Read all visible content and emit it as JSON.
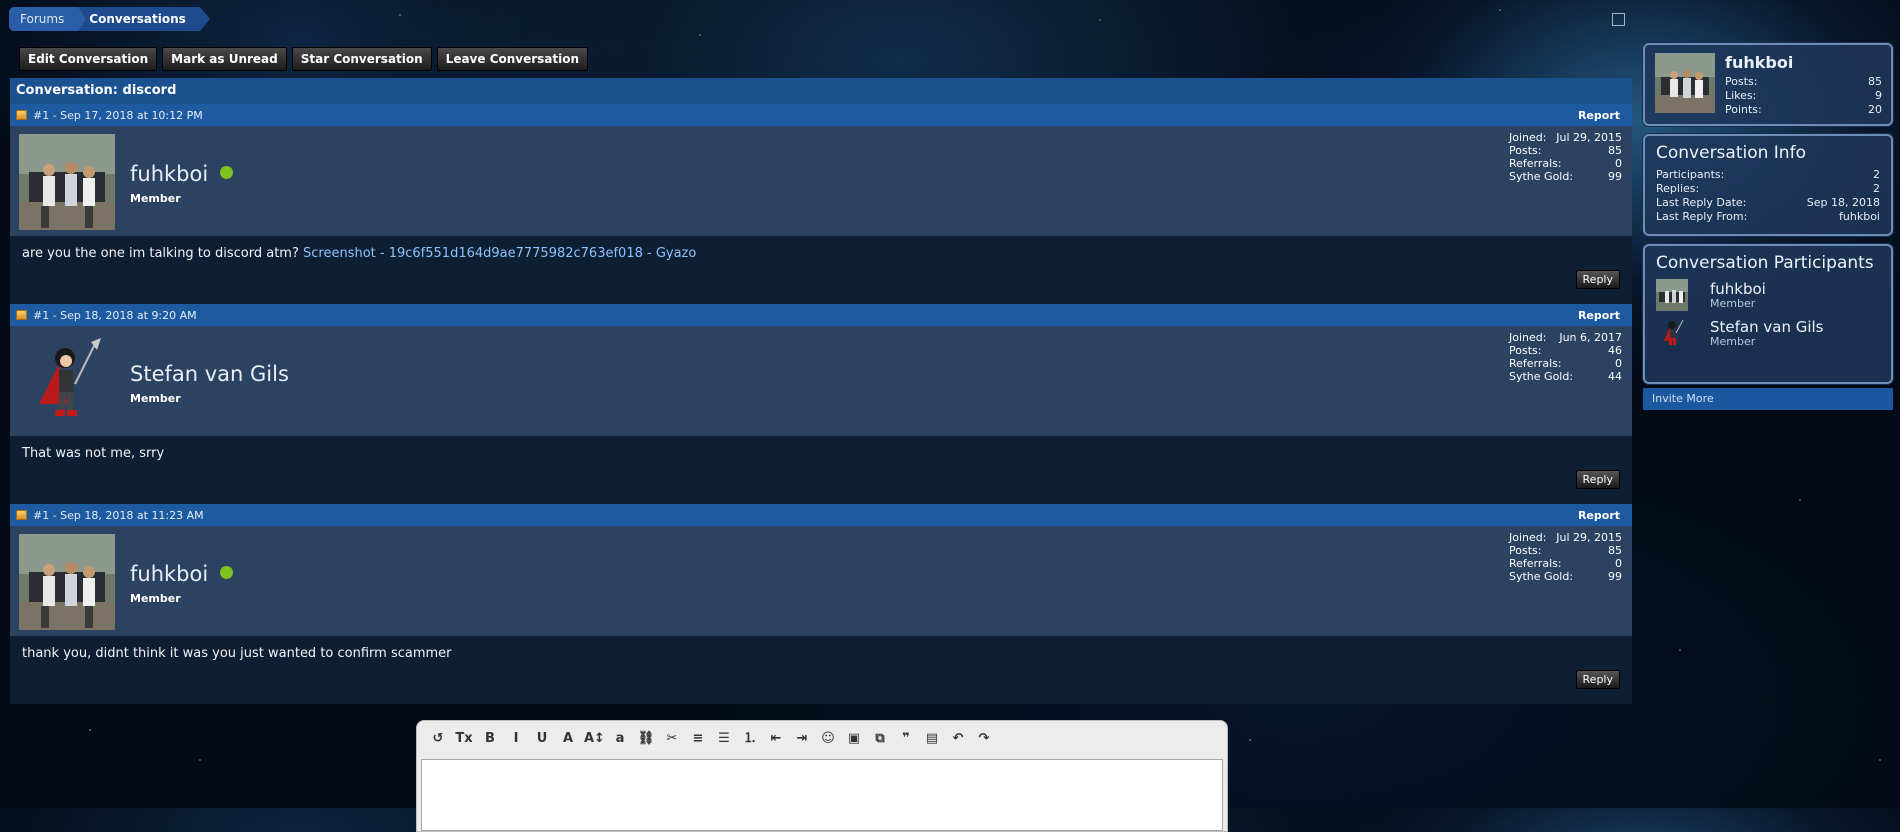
{
  "breadcrumb": {
    "forums": "Forums",
    "conversations": "Conversations"
  },
  "actions": {
    "edit": "Edit Conversation",
    "mark_unread": "Mark as Unread",
    "star": "Star Conversation",
    "leave": "Leave Conversation"
  },
  "conversation": {
    "title": "Conversation: discord"
  },
  "posts": [
    {
      "meta": "#1 - Sep 17, 2018 at 10:12 PM",
      "report": "Report",
      "username": "fuhkboi",
      "role": "Member",
      "online": true,
      "stats": {
        "joined_label": "Joined:",
        "joined": "Jul 29, 2015",
        "posts_label": "Posts:",
        "posts": "85",
        "referrals_label": "Referrals:",
        "referrals": "0",
        "gold_label": "Sythe Gold:",
        "gold": "99"
      },
      "message": "are you the one im talking to discord atm?",
      "link": "Screenshot - 19c6f551d164d9ae7775982c763ef018 - Gyazo",
      "reply": "Reply"
    },
    {
      "meta": "#1 - Sep 18, 2018 at 9:20 AM",
      "report": "Report",
      "username": "Stefan van Gils",
      "role": "Member",
      "online": false,
      "stats": {
        "joined_label": "Joined:",
        "joined": "Jun 6, 2017",
        "posts_label": "Posts:",
        "posts": "46",
        "referrals_label": "Referrals:",
        "referrals": "0",
        "gold_label": "Sythe Gold:",
        "gold": "44"
      },
      "message": "That was not me, srry",
      "link": "",
      "reply": "Reply"
    },
    {
      "meta": "#1 - Sep 18, 2018 at 11:23 AM",
      "report": "Report",
      "username": "fuhkboi",
      "role": "Member",
      "online": true,
      "stats": {
        "joined_label": "Joined:",
        "joined": "Jul 29, 2015",
        "posts_label": "Posts:",
        "posts": "85",
        "referrals_label": "Referrals:",
        "referrals": "0",
        "gold_label": "Sythe Gold:",
        "gold": "99"
      },
      "message": "thank you, didnt think it was you just wanted to confirm scammer",
      "link": "",
      "reply": "Reply"
    }
  ],
  "sidebar": {
    "profile": {
      "name": "fuhkboi",
      "posts_label": "Posts:",
      "posts": "85",
      "likes_label": "Likes:",
      "likes": "9",
      "points_label": "Points:",
      "points": "20"
    },
    "info": {
      "title": "Conversation Info",
      "participants_label": "Participants:",
      "participants": "2",
      "replies_label": "Replies:",
      "replies": "2",
      "last_date_label": "Last Reply Date:",
      "last_date": "Sep 18, 2018",
      "last_from_label": "Last Reply From:",
      "last_from": "fuhkboi"
    },
    "participants": {
      "title": "Conversation Participants",
      "list": [
        {
          "name": "fuhkboi",
          "role": "Member"
        },
        {
          "name": "Stefan van Gils",
          "role": "Member"
        }
      ],
      "invite": "Invite More"
    }
  },
  "editor": {
    "tools": [
      "remove-format-icon",
      "clear-formatting-icon",
      "bold-icon",
      "italic-icon",
      "underline-icon",
      "font-color-icon",
      "font-size-icon",
      "font-family-icon",
      "link-icon",
      "unlink-icon",
      "align-icon",
      "bullet-list-icon",
      "numbered-list-icon",
      "outdent-icon",
      "indent-icon",
      "smilie-icon",
      "image-icon",
      "media-icon",
      "quote-icon",
      "save-draft-icon",
      "undo-icon",
      "redo-icon"
    ],
    "glyphs": [
      "↺",
      "Tx",
      "B",
      "I",
      "U",
      "A",
      "A↕",
      "a",
      "⛓",
      "✂",
      "≡",
      "☰",
      "⒈",
      "⇤",
      "⇥",
      "☺",
      "▣",
      "⧉",
      "❞",
      "▤",
      "↶",
      "↷"
    ]
  },
  "colors": {
    "accent": "#1d5aa0",
    "online": "#7dc11a",
    "link": "#8cc2ff"
  }
}
